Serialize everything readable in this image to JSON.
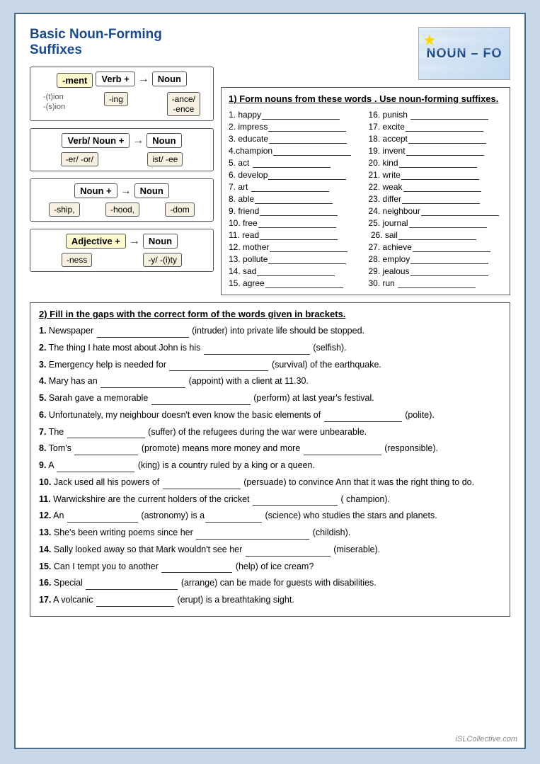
{
  "page": {
    "title": "Basic Noun-Forming Suffixes",
    "noun_image_alt": "NOUN - FO",
    "watermark": "iSLCollective.com"
  },
  "diagrams": {
    "diagram1": {
      "top": "Verb +",
      "arrow": "→",
      "result": "Noun",
      "left_label": "-ment",
      "branches": [
        "-ing",
        "-ance/ -ence"
      ],
      "left_branch": "-(t)ion -(s)ion"
    },
    "diagram2": {
      "top": "Verb/ Noun +",
      "arrow": "→",
      "result": "Noun",
      "branches": [
        "-er/ -or/",
        "ist/ -ee"
      ]
    },
    "diagram3": {
      "top": "Noun +",
      "arrow": "→",
      "result": "Noun",
      "branches": [
        "-ship,",
        "-hood,",
        "-dom"
      ]
    },
    "diagram4": {
      "top": "Adjective +",
      "arrow": "→",
      "result": "Noun",
      "branches": [
        "-ness",
        "-y/ -(i)ty"
      ]
    }
  },
  "exercise1": {
    "title": "1) Form nouns from these words . Use noun-forming suffixes.",
    "items_left": [
      "1. happy",
      "2. impress",
      "3. educate",
      "4.champion",
      "5. act",
      "6. develop",
      "7. art",
      "8. able",
      "9. friend",
      "10. free",
      "11. read",
      "12. mother",
      "13. pollute",
      "14. sad",
      "15. agree"
    ],
    "items_right": [
      "16. punish",
      "17. excite",
      "18. accept",
      "19. invent",
      "20. kind",
      "21. write",
      "22. weak",
      "23. differ",
      "24. neighbour",
      "25. journal",
      " 26. sail",
      "27. achieve",
      "28. employ",
      "29. jealous",
      "30. run"
    ]
  },
  "exercise2": {
    "title": "2) Fill in the gaps with the correct form of the words given in brackets.",
    "items": [
      {
        "num": "1.",
        "text_before": "Newspaper",
        "blank": true,
        "text_after": "(intruder) into private life should be stopped."
      },
      {
        "num": "2.",
        "text_before": "The thing I hate most about John is his",
        "blank": true,
        "text_after": "(selfish)."
      },
      {
        "num": "3.",
        "text_before": "Emergency help is needed for",
        "blank": true,
        "text_after": "(survival) of the earthquake."
      },
      {
        "num": "4.",
        "text_before": "Mary has an",
        "blank": true,
        "text_after": "(appoint) with a client at 11.30."
      },
      {
        "num": "5.",
        "text_before": "Sarah gave a memorable",
        "blank": true,
        "text_after": "(perform) at last year's festival."
      },
      {
        "num": "6.",
        "text_before": "Unfortunately, my neighbour doesn’t even know the basic elements of",
        "blank": true,
        "text_after": "(polite)."
      },
      {
        "num": "7.",
        "text_before": "The",
        "blank": true,
        "text_after": "(suffer) of the refugees during the war were unbearable."
      },
      {
        "num": "8.",
        "text_before": "Tom’s",
        "blank": true,
        "text_after": "(promote) means more money and more",
        "blank2": true,
        "text_after2": "(responsible)."
      },
      {
        "num": "9.",
        "text_before": "A",
        "blank": true,
        "text_after": "(king) is a country ruled by a king or a queen."
      },
      {
        "num": "10.",
        "text_before": "Jack used all his powers of",
        "blank": true,
        "text_after": "(persuade) to convince Ann that it was the right thing to do."
      },
      {
        "num": "11.",
        "text_before": "Warwickshire are the current holders of the cricket",
        "blank": true,
        "text_after": "( champion)."
      },
      {
        "num": "12.",
        "text_before": "An",
        "blank": true,
        "text_after": "(astronomy) is a",
        "blank2": true,
        "text_after2": "(science) who studies the stars and planets."
      },
      {
        "num": "13.",
        "text_before": "She’s been writing poems since her",
        "blank": true,
        "text_after": "(childish)."
      },
      {
        "num": "14.",
        "text_before": "Sally looked away so that Mark wouldn’t see her",
        "blank": true,
        "text_after": "(miserable)."
      },
      {
        "num": "15.",
        "text_before": "Can I tempt you to another",
        "blank": true,
        "text_after": "(help) of ice cream?"
      },
      {
        "num": "16.",
        "text_before": "Special",
        "blank": true,
        "text_after": "(arrange) can be made for guests with disabilities."
      },
      {
        "num": "17.",
        "text_before": "A volcanic",
        "blank": true,
        "text_after": "(erupt) is a breathtaking sight."
      }
    ]
  }
}
